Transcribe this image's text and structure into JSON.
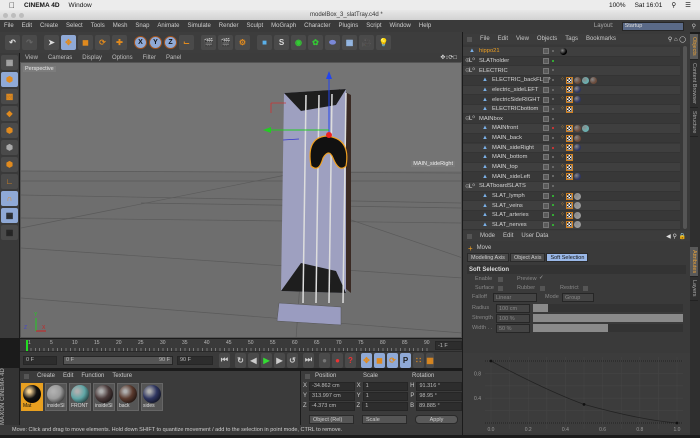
{
  "macbar": {
    "app": "CINEMA 4D",
    "menu": "Window",
    "battery": "100%",
    "clock": "Sat 16:01"
  },
  "window": {
    "title": "modelBox_3_slatTray.c4d *"
  },
  "app_menu": [
    "File",
    "Edit",
    "Create",
    "Select",
    "Tools",
    "Mesh",
    "Snap",
    "Animate",
    "Simulate",
    "Render",
    "Sculpt",
    "MoGraph",
    "Character",
    "Plugins",
    "Script",
    "Window",
    "Help"
  ],
  "layout": {
    "label": "Layout:",
    "value": "Startup"
  },
  "toolbar": {
    "axis": [
      "X",
      "Y",
      "Z"
    ]
  },
  "viewport": {
    "menu": [
      "View",
      "Cameras",
      "Display",
      "Options",
      "Filter",
      "Panel"
    ],
    "camera": "Perspective",
    "hover_label": "MAIN_sideRight",
    "axes": [
      "Y",
      "Z",
      "X"
    ]
  },
  "timeline": {
    "ticks": [
      "1",
      "5",
      "10",
      "15",
      "20",
      "25",
      "30",
      "35",
      "40",
      "45",
      "50",
      "55",
      "60",
      "65",
      "70",
      "75",
      "80",
      "85",
      "90"
    ],
    "current": "-1 F",
    "start": "0 F",
    "range_start": "0 F",
    "range_end": "90 F",
    "end": "90 F"
  },
  "materials": {
    "menu": [
      "Create",
      "Edit",
      "Function",
      "Texture"
    ],
    "items": [
      {
        "name": "Mat",
        "color": "#111111",
        "selected": true
      },
      {
        "name": "insideSl",
        "color": "#9a9a9a"
      },
      {
        "name": "FRONT",
        "color": "#5fa6a6"
      },
      {
        "name": "insideSl",
        "color": "#4a3a3a"
      },
      {
        "name": "back",
        "color": "#5a3a2e"
      },
      {
        "name": "sides",
        "color": "#2e3560"
      }
    ]
  },
  "coordinates": {
    "headers": [
      "Position",
      "Scale",
      "Rotation"
    ],
    "rows": [
      {
        "axis": "X",
        "pos": "-34.862 cm",
        "scale": "1",
        "raxis": "H",
        "rot": "91.316 °"
      },
      {
        "axis": "Y",
        "pos": "313.997 cm",
        "scale": "1",
        "raxis": "P",
        "rot": "98.95 °"
      },
      {
        "axis": "Z",
        "pos": "-4.373 cm",
        "scale": "1",
        "raxis": "B",
        "rot": "89.885 °"
      }
    ],
    "mode": "Object (Rel)",
    "scale_mode": "Scale",
    "apply": "Apply"
  },
  "maxon": "MAXON CINEMA 4D",
  "status": "Move: Click and drag to move elements. Hold down SHIFT to quantize movement / add to the selection in point mode, CTRL to remove.",
  "objects": {
    "menu": [
      "File",
      "Edit",
      "View",
      "Objects",
      "Tags",
      "Bookmarks"
    ],
    "items": [
      {
        "name": "hippo21",
        "level": 0,
        "type": "poly",
        "highlight": true,
        "tags": [
          "black"
        ]
      },
      {
        "name": "SLATholder",
        "level": 0,
        "type": "null",
        "expand": "+",
        "dot": "#3c3"
      },
      {
        "name": "ELECTRIC",
        "level": 0,
        "type": "null",
        "expand": "-"
      },
      {
        "name": "ELECTRIC_backFLAP",
        "level": 1,
        "type": "poly",
        "tags": [
          "p",
          "t",
          "#6a4a3a",
          "#6ab0b0",
          "#6a4a3a"
        ]
      },
      {
        "name": "electric_sideLEFT",
        "level": 1,
        "type": "poly",
        "tags": [
          "p",
          "t",
          "#2e3560"
        ]
      },
      {
        "name": "electricSideRIGHT",
        "level": 1,
        "type": "poly",
        "tags": [
          "p",
          "t",
          "#2e3560"
        ]
      },
      {
        "name": "ELECTRICbottom",
        "level": 1,
        "type": "poly",
        "tags": [
          "p",
          "t"
        ]
      },
      {
        "name": "MAINbox",
        "level": 0,
        "type": "null",
        "expand": "-"
      },
      {
        "name": "MAINfront",
        "level": 1,
        "type": "poly",
        "dot": "#e33",
        "tags": [
          "p",
          "t",
          "#6a4a3a",
          "#6ab0b0"
        ]
      },
      {
        "name": "MAIN_back",
        "level": 1,
        "type": "poly",
        "tags": [
          "p",
          "t",
          "#6a4a3a"
        ]
      },
      {
        "name": "MAIN_sideRight",
        "level": 1,
        "type": "poly",
        "dot": "#e33",
        "tags": [
          "p",
          "t",
          "#2e3560"
        ]
      },
      {
        "name": "MAIN_bottom",
        "level": 1,
        "type": "poly",
        "tags": [
          "p",
          "t"
        ]
      },
      {
        "name": "MAIN_top",
        "level": 1,
        "type": "poly",
        "tags": [
          "p",
          "t"
        ]
      },
      {
        "name": "MAIN_sideLeft",
        "level": 1,
        "type": "poly",
        "tags": [
          "p",
          "t",
          "#2e3560"
        ]
      },
      {
        "name": "SLATboardSLATS",
        "level": 0,
        "type": "null",
        "expand": "-"
      },
      {
        "name": "SLAT_lymph",
        "level": 1,
        "type": "poly",
        "dot": "#3c3",
        "tags": [
          "p",
          "t",
          "#9a9a9a"
        ]
      },
      {
        "name": "SLAT_veins",
        "level": 1,
        "type": "poly",
        "dot": "#3c3",
        "tags": [
          "p",
          "t",
          "#9a9a9a"
        ]
      },
      {
        "name": "SLAT_arteries",
        "level": 1,
        "type": "poly",
        "dot": "#3c3",
        "tags": [
          "p",
          "t",
          "#9a9a9a"
        ]
      },
      {
        "name": "SLAT_nerves",
        "level": 1,
        "type": "poly",
        "dot": "#3c3",
        "tags": [
          "p",
          "t",
          "#9a9a9a"
        ]
      }
    ]
  },
  "attributes": {
    "menu": [
      "Mode",
      "Edit",
      "User Data"
    ],
    "tool": "Move",
    "tabs": [
      "Modeling Axis",
      "Object Axis",
      "Soft Selection"
    ],
    "active_tab": 2,
    "section": "Soft Selection",
    "enable": "Enable",
    "preview": "Preview",
    "surface": "Surface",
    "rubber": "Rubber",
    "restrict": "Restrict",
    "falloff_label": "Falloff",
    "falloff": "Linear",
    "mode_label": "Mode",
    "mode": "Group",
    "radius_label": "Radius",
    "radius": "100 cm",
    "radius_frac": 0.1,
    "strength_label": "Strength",
    "strength": "100 %",
    "strength_frac": 1.0,
    "width_label": "Width . .",
    "width": "50 %",
    "width_frac": 0.5
  },
  "vtabs": [
    "Objects",
    "Content Browser",
    "Structure",
    "Attributes",
    "Layers"
  ],
  "chart_data": {
    "type": "line",
    "title": "",
    "xlabel": "",
    "ylabel": "",
    "x_ticks": [
      "0.0",
      "0.2",
      "0.4",
      "0.6",
      "0.8",
      "1.0"
    ],
    "y_ticks": [
      "0.4",
      "0.8"
    ],
    "xlim": [
      0,
      1
    ],
    "ylim": [
      0,
      1
    ],
    "grid": true,
    "points": [
      [
        0,
        1
      ],
      [
        0.5,
        0.3
      ],
      [
        1,
        0
      ]
    ]
  }
}
